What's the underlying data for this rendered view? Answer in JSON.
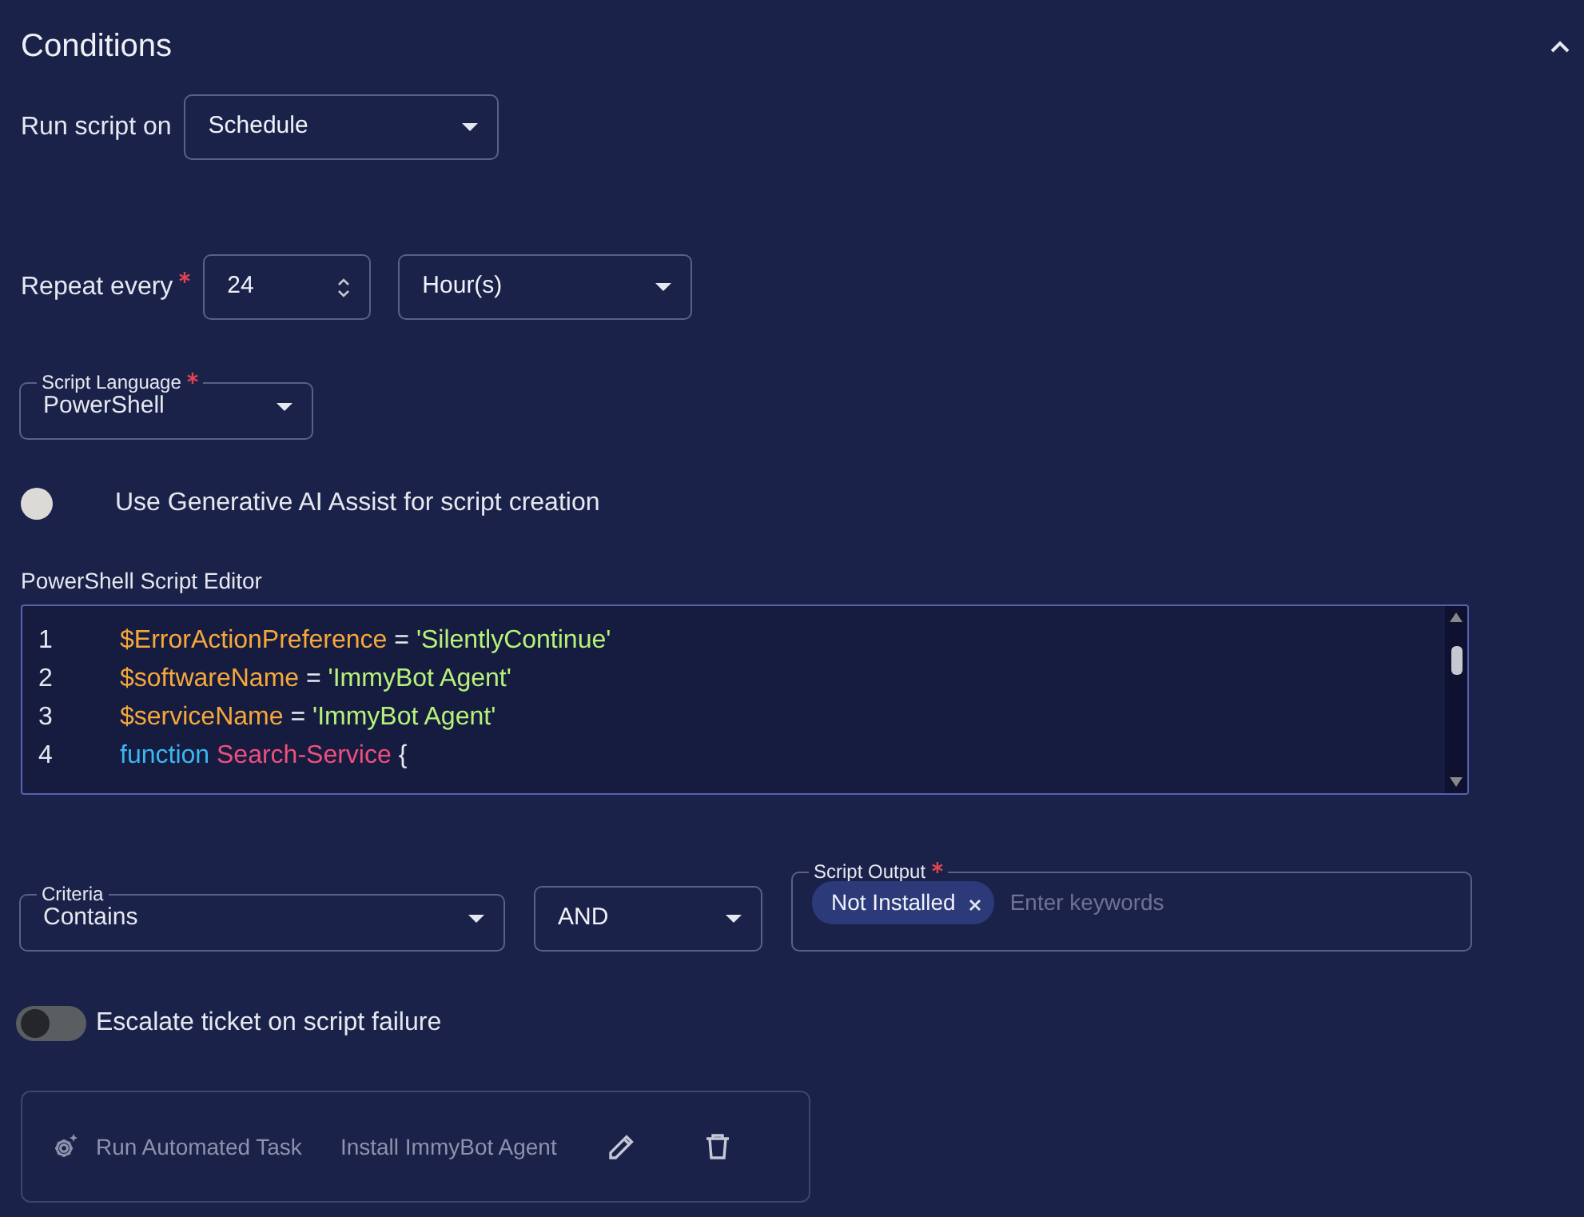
{
  "section": {
    "title": "Conditions",
    "expanded": true
  },
  "run_script_on": {
    "label": "Run script on",
    "value": "Schedule"
  },
  "repeat": {
    "label": "Repeat every",
    "required": true,
    "value": "24",
    "unit": "Hour(s)"
  },
  "script_language": {
    "label": "Script Language",
    "required": true,
    "value": "PowerShell"
  },
  "ai_assist": {
    "label": "Use Generative AI Assist for script creation",
    "on": false,
    "disabled": true
  },
  "editor": {
    "label": "PowerShell Script Editor",
    "lines": [
      {
        "number": "1",
        "tokens": [
          {
            "kind": "variable",
            "text": "$ErrorActionPreference"
          },
          {
            "kind": "plain",
            "text": "="
          },
          {
            "kind": "string",
            "text": "'SilentlyContinue'"
          }
        ]
      },
      {
        "number": "2",
        "tokens": [
          {
            "kind": "variable",
            "text": "$softwareName"
          },
          {
            "kind": "plain",
            "text": "="
          },
          {
            "kind": "string",
            "text": "'ImmyBot Agent'"
          }
        ]
      },
      {
        "number": "3",
        "tokens": [
          {
            "kind": "variable",
            "text": "$serviceName"
          },
          {
            "kind": "plain",
            "text": "="
          },
          {
            "kind": "string",
            "text": "'ImmyBot Agent'"
          }
        ]
      },
      {
        "number": "4",
        "tokens": [
          {
            "kind": "keyword",
            "text": "function"
          },
          {
            "kind": "function",
            "text": "Search-Service"
          },
          {
            "kind": "punct",
            "text": "{"
          }
        ]
      }
    ]
  },
  "criteria": {
    "label": "Criteria",
    "value": "Contains"
  },
  "operator": {
    "value": "AND"
  },
  "script_output": {
    "label": "Script Output",
    "required": true,
    "tags": [
      "Not Installed"
    ],
    "placeholder": "Enter keywords"
  },
  "escalate": {
    "label": "Escalate ticket on script failure",
    "on": false,
    "disabled": false
  },
  "action": {
    "type": "Run Automated Task",
    "name": "Install ImmyBot Agent"
  }
}
